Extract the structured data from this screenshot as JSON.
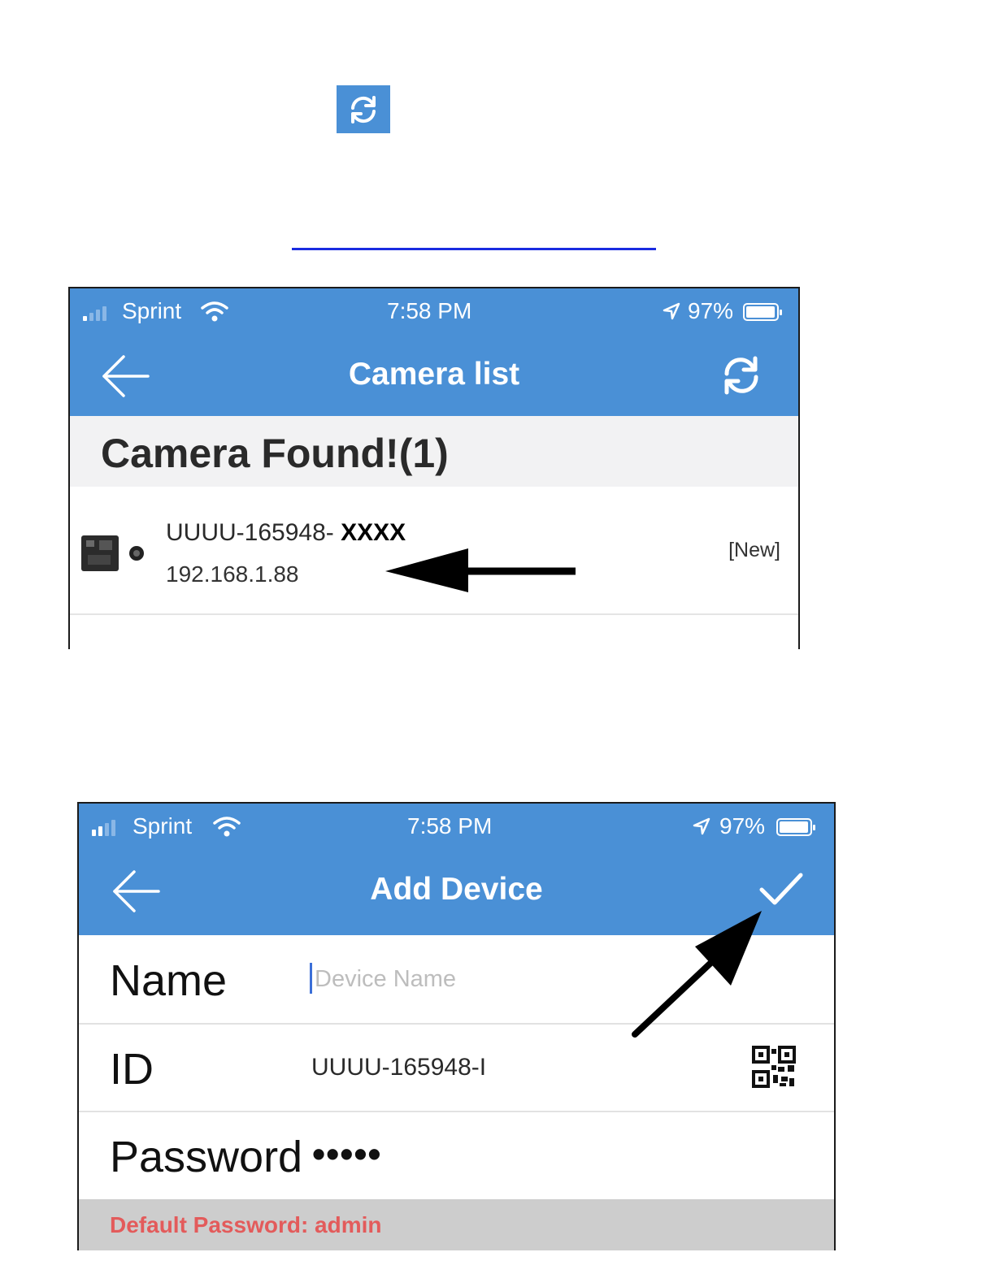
{
  "doc": {
    "refresh_icon": "refresh-icon",
    "link_text": ""
  },
  "camera_list_screen": {
    "status": {
      "carrier": "Sprint",
      "time": "7:58 PM",
      "battery": "97%"
    },
    "title": "Camera list",
    "icons": {
      "back": "back-arrow-icon",
      "refresh": "refresh-icon"
    },
    "section_title": "Camera Found!(1)",
    "cameras": [
      {
        "id_prefix": "UUUU-165948- ",
        "id_suffix": "XXXX",
        "ip": "192.168.1.88",
        "tag": "[New]"
      }
    ]
  },
  "add_device_screen": {
    "status": {
      "carrier": "Sprint",
      "time": "7:58 PM",
      "battery": "97%"
    },
    "title": "Add Device",
    "icons": {
      "back": "back-arrow-icon",
      "confirm": "checkmark-icon",
      "qr": "qr-code-icon"
    },
    "fields": {
      "name_label": "Name",
      "name_placeholder": "Device Name",
      "id_label": "ID",
      "id_value": "UUUU-165948-I",
      "password_label": "Password",
      "password_value": "•••••"
    },
    "hint": "Default Password: admin"
  }
}
